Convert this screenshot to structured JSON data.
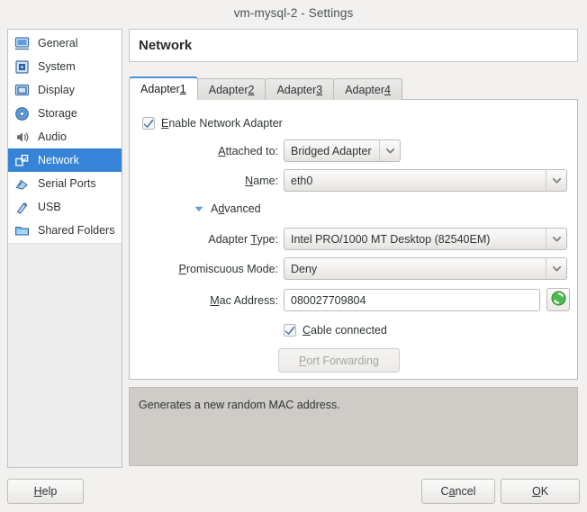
{
  "window": {
    "title": "vm-mysql-2 - Settings"
  },
  "sidebar": {
    "items": [
      {
        "label": "General",
        "icon": "monitor-icon",
        "selected": false
      },
      {
        "label": "System",
        "icon": "chip-icon",
        "selected": false
      },
      {
        "label": "Display",
        "icon": "display-icon",
        "selected": false
      },
      {
        "label": "Storage",
        "icon": "disc-icon",
        "selected": false
      },
      {
        "label": "Audio",
        "icon": "speaker-icon",
        "selected": false
      },
      {
        "label": "Network",
        "icon": "network-icon",
        "selected": true
      },
      {
        "label": "Serial Ports",
        "icon": "serial-port-icon",
        "selected": false
      },
      {
        "label": "USB",
        "icon": "usb-icon",
        "selected": false
      },
      {
        "label": "Shared Folders",
        "icon": "folder-icon",
        "selected": false
      }
    ]
  },
  "header": {
    "title": "Network"
  },
  "tabs": [
    {
      "label": "Adapter ",
      "mnemonic": "1",
      "active": true
    },
    {
      "label": "Adapter ",
      "mnemonic": "2",
      "active": false
    },
    {
      "label": "Adapter ",
      "mnemonic": "3",
      "active": false
    },
    {
      "label": "Adapter ",
      "mnemonic": "4",
      "active": false
    }
  ],
  "form": {
    "enable_adapter": {
      "label_pre": "",
      "label_mn": "E",
      "label_post": "nable Network Adapter",
      "checked": true
    },
    "attached_to": {
      "label_pre": "",
      "label_mn": "A",
      "label_post": "ttached to:",
      "value": "Bridged Adapter"
    },
    "name": {
      "label_pre": "",
      "label_mn": "N",
      "label_post": "ame:",
      "value": "eth0"
    },
    "advanced": {
      "label_pre": "A",
      "label_mn": "d",
      "label_post": "vanced",
      "expanded": true
    },
    "adapter_type": {
      "label_pre": "Adapter ",
      "label_mn": "T",
      "label_post": "ype:",
      "value": "Intel PRO/1000 MT Desktop (82540EM)"
    },
    "promiscuous_mode": {
      "label_pre": "",
      "label_mn": "P",
      "label_post": "romiscuous Mode:",
      "value": "Deny"
    },
    "mac_address": {
      "label_pre": "",
      "label_mn": "M",
      "label_post": "ac Address:",
      "value": "080027709804"
    },
    "refresh_mac": {
      "icon": "refresh-icon",
      "tooltip": "Generates a new random MAC address."
    },
    "cable_connected": {
      "label_pre": "",
      "label_mn": "C",
      "label_post": "able connected",
      "checked": true
    },
    "port_forwarding": {
      "label_pre": "",
      "label_mn": "P",
      "label_post": "ort Forwarding",
      "disabled": true
    }
  },
  "info": {
    "text": "Generates a new random MAC address."
  },
  "buttons": {
    "help": {
      "label_pre": "",
      "label_mn": "H",
      "label_post": "elp"
    },
    "cancel": {
      "label_pre": "C",
      "label_mn": "a",
      "label_post": "ncel"
    },
    "ok": {
      "label_pre": "",
      "label_mn": "O",
      "label_post": "K"
    }
  },
  "colors": {
    "selection": "#3584d8",
    "accent_tab": "#4a90d9",
    "checkmark": "#3c6eb4",
    "refresh_green": "#3faa3f",
    "window_bg": "#f2f1f0",
    "info_bg": "#cfcbc6"
  }
}
